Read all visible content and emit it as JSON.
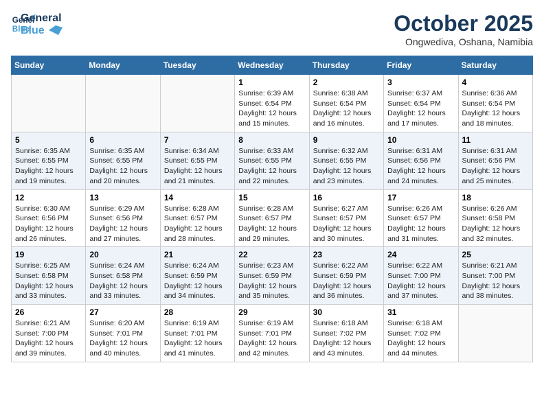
{
  "header": {
    "logo_line1": "General",
    "logo_line2": "Blue",
    "month": "October 2025",
    "location": "Ongwediva, Oshana, Namibia"
  },
  "days_of_week": [
    "Sunday",
    "Monday",
    "Tuesday",
    "Wednesday",
    "Thursday",
    "Friday",
    "Saturday"
  ],
  "weeks": [
    [
      {
        "day": "",
        "info": ""
      },
      {
        "day": "",
        "info": ""
      },
      {
        "day": "",
        "info": ""
      },
      {
        "day": "1",
        "info": "Sunrise: 6:39 AM\nSunset: 6:54 PM\nDaylight: 12 hours\nand 15 minutes."
      },
      {
        "day": "2",
        "info": "Sunrise: 6:38 AM\nSunset: 6:54 PM\nDaylight: 12 hours\nand 16 minutes."
      },
      {
        "day": "3",
        "info": "Sunrise: 6:37 AM\nSunset: 6:54 PM\nDaylight: 12 hours\nand 17 minutes."
      },
      {
        "day": "4",
        "info": "Sunrise: 6:36 AM\nSunset: 6:54 PM\nDaylight: 12 hours\nand 18 minutes."
      }
    ],
    [
      {
        "day": "5",
        "info": "Sunrise: 6:35 AM\nSunset: 6:55 PM\nDaylight: 12 hours\nand 19 minutes."
      },
      {
        "day": "6",
        "info": "Sunrise: 6:35 AM\nSunset: 6:55 PM\nDaylight: 12 hours\nand 20 minutes."
      },
      {
        "day": "7",
        "info": "Sunrise: 6:34 AM\nSunset: 6:55 PM\nDaylight: 12 hours\nand 21 minutes."
      },
      {
        "day": "8",
        "info": "Sunrise: 6:33 AM\nSunset: 6:55 PM\nDaylight: 12 hours\nand 22 minutes."
      },
      {
        "day": "9",
        "info": "Sunrise: 6:32 AM\nSunset: 6:55 PM\nDaylight: 12 hours\nand 23 minutes."
      },
      {
        "day": "10",
        "info": "Sunrise: 6:31 AM\nSunset: 6:56 PM\nDaylight: 12 hours\nand 24 minutes."
      },
      {
        "day": "11",
        "info": "Sunrise: 6:31 AM\nSunset: 6:56 PM\nDaylight: 12 hours\nand 25 minutes."
      }
    ],
    [
      {
        "day": "12",
        "info": "Sunrise: 6:30 AM\nSunset: 6:56 PM\nDaylight: 12 hours\nand 26 minutes."
      },
      {
        "day": "13",
        "info": "Sunrise: 6:29 AM\nSunset: 6:56 PM\nDaylight: 12 hours\nand 27 minutes."
      },
      {
        "day": "14",
        "info": "Sunrise: 6:28 AM\nSunset: 6:57 PM\nDaylight: 12 hours\nand 28 minutes."
      },
      {
        "day": "15",
        "info": "Sunrise: 6:28 AM\nSunset: 6:57 PM\nDaylight: 12 hours\nand 29 minutes."
      },
      {
        "day": "16",
        "info": "Sunrise: 6:27 AM\nSunset: 6:57 PM\nDaylight: 12 hours\nand 30 minutes."
      },
      {
        "day": "17",
        "info": "Sunrise: 6:26 AM\nSunset: 6:57 PM\nDaylight: 12 hours\nand 31 minutes."
      },
      {
        "day": "18",
        "info": "Sunrise: 6:26 AM\nSunset: 6:58 PM\nDaylight: 12 hours\nand 32 minutes."
      }
    ],
    [
      {
        "day": "19",
        "info": "Sunrise: 6:25 AM\nSunset: 6:58 PM\nDaylight: 12 hours\nand 33 minutes."
      },
      {
        "day": "20",
        "info": "Sunrise: 6:24 AM\nSunset: 6:58 PM\nDaylight: 12 hours\nand 33 minutes."
      },
      {
        "day": "21",
        "info": "Sunrise: 6:24 AM\nSunset: 6:59 PM\nDaylight: 12 hours\nand 34 minutes."
      },
      {
        "day": "22",
        "info": "Sunrise: 6:23 AM\nSunset: 6:59 PM\nDaylight: 12 hours\nand 35 minutes."
      },
      {
        "day": "23",
        "info": "Sunrise: 6:22 AM\nSunset: 6:59 PM\nDaylight: 12 hours\nand 36 minutes."
      },
      {
        "day": "24",
        "info": "Sunrise: 6:22 AM\nSunset: 7:00 PM\nDaylight: 12 hours\nand 37 minutes."
      },
      {
        "day": "25",
        "info": "Sunrise: 6:21 AM\nSunset: 7:00 PM\nDaylight: 12 hours\nand 38 minutes."
      }
    ],
    [
      {
        "day": "26",
        "info": "Sunrise: 6:21 AM\nSunset: 7:00 PM\nDaylight: 12 hours\nand 39 minutes."
      },
      {
        "day": "27",
        "info": "Sunrise: 6:20 AM\nSunset: 7:01 PM\nDaylight: 12 hours\nand 40 minutes."
      },
      {
        "day": "28",
        "info": "Sunrise: 6:19 AM\nSunset: 7:01 PM\nDaylight: 12 hours\nand 41 minutes."
      },
      {
        "day": "29",
        "info": "Sunrise: 6:19 AM\nSunset: 7:01 PM\nDaylight: 12 hours\nand 42 minutes."
      },
      {
        "day": "30",
        "info": "Sunrise: 6:18 AM\nSunset: 7:02 PM\nDaylight: 12 hours\nand 43 minutes."
      },
      {
        "day": "31",
        "info": "Sunrise: 6:18 AM\nSunset: 7:02 PM\nDaylight: 12 hours\nand 44 minutes."
      },
      {
        "day": "",
        "info": ""
      }
    ]
  ]
}
